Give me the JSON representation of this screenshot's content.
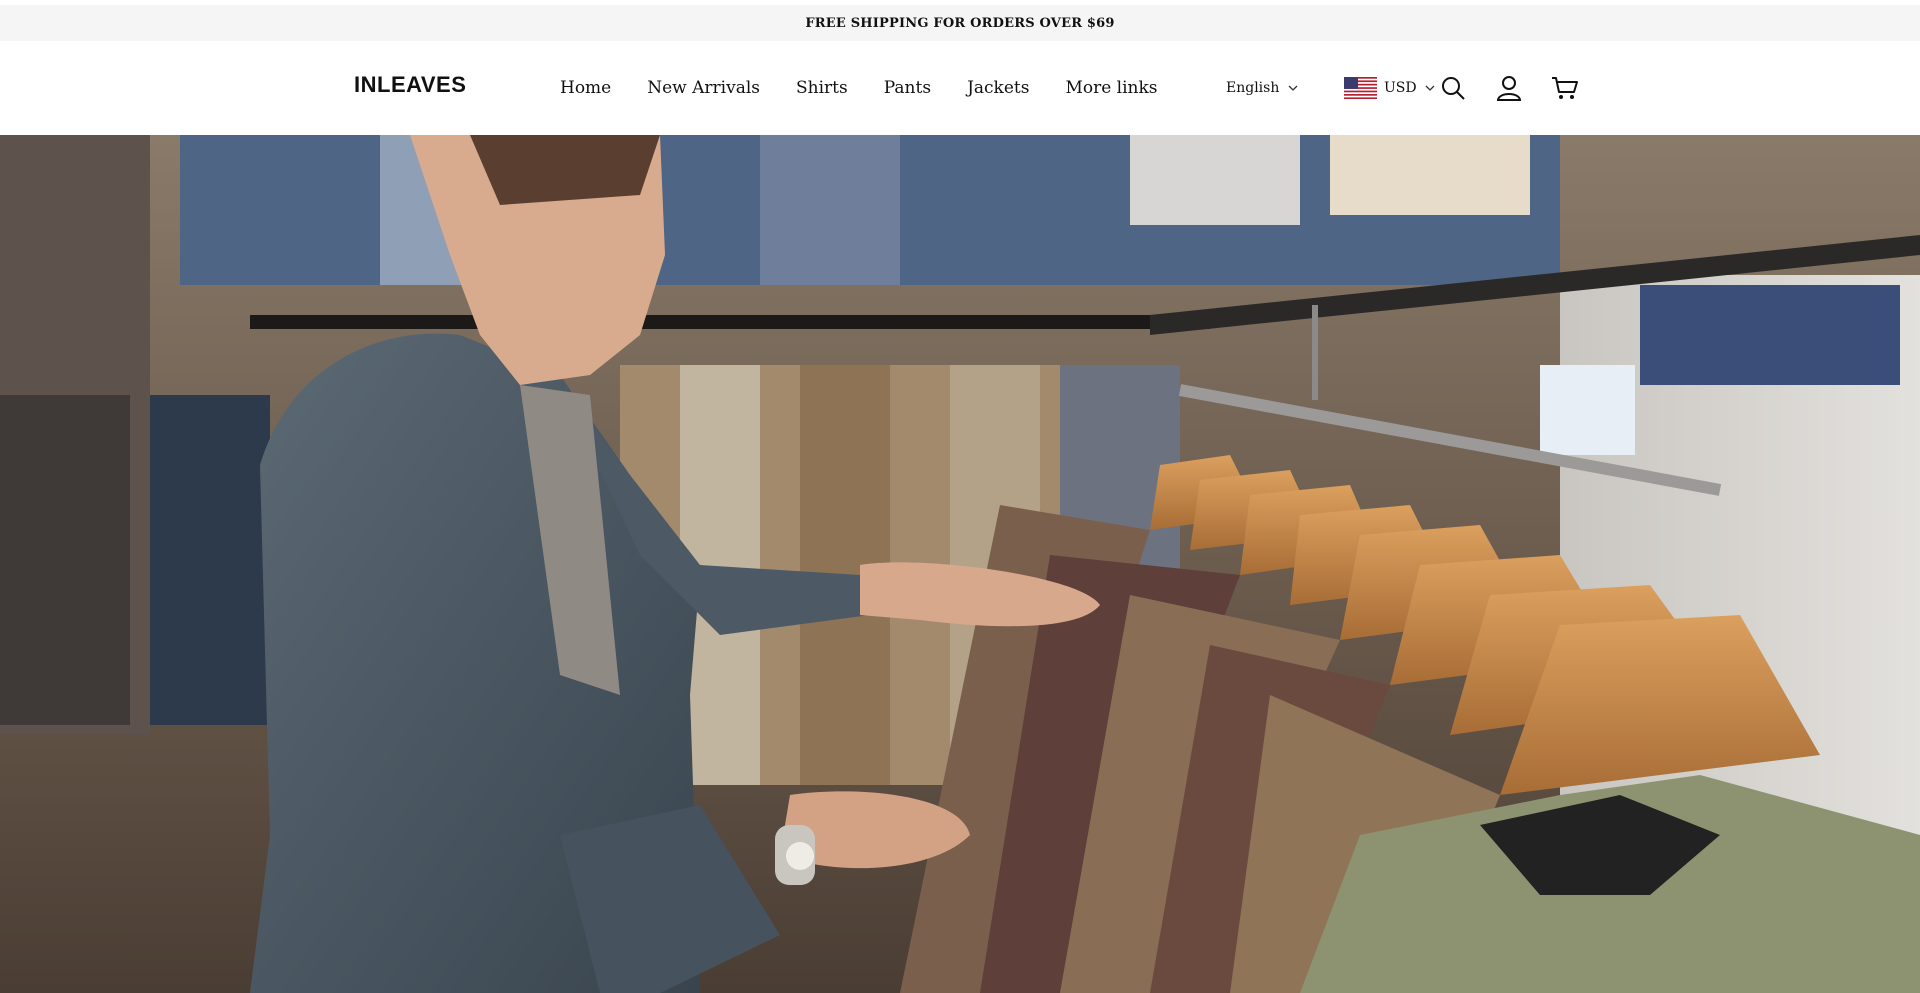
{
  "announcement": {
    "text": "FREE SHIPPING FOR ORDERS OVER $69"
  },
  "header": {
    "logo": "INLEAVES",
    "nav": [
      {
        "label": "Home"
      },
      {
        "label": "New Arrivals"
      },
      {
        "label": "Shirts"
      },
      {
        "label": "Pants"
      },
      {
        "label": "Jackets"
      },
      {
        "label": "More links"
      }
    ],
    "language": {
      "selected": "English",
      "icon": "chevron-down-icon"
    },
    "currency": {
      "selected": "USD",
      "flag": "us-flag-icon",
      "icon": "chevron-down-icon"
    },
    "icons": [
      "search-icon",
      "account-icon",
      "cart-icon"
    ]
  },
  "hero": {
    "image": "man-in-denim-jacket-browsing-blazers-on-rack",
    "colors": {
      "denim": "#4d5a66",
      "hanger": "#c98a4c",
      "blazer_brown": "#6a4a3f",
      "shirt_green": "#8d9370"
    }
  }
}
